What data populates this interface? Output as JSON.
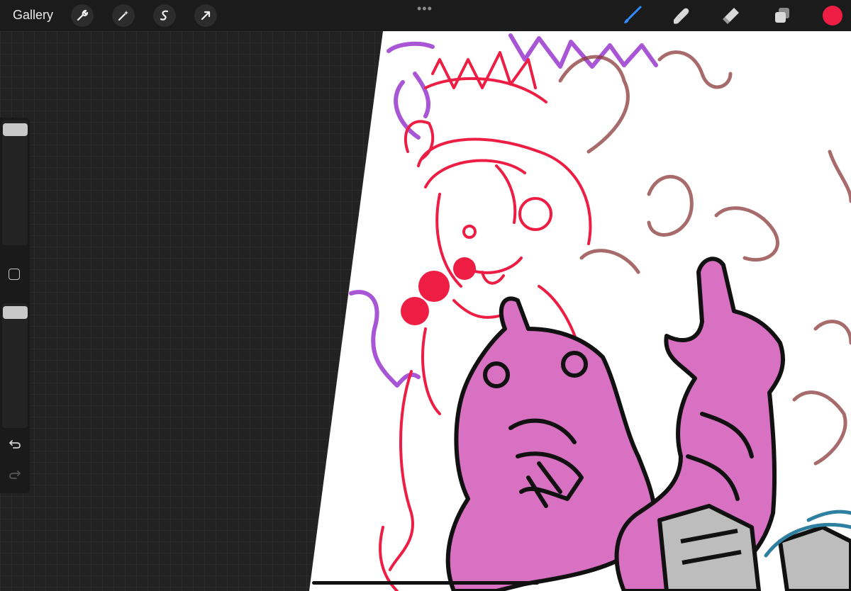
{
  "topbar": {
    "gallery_label": "Gallery",
    "left_tools": [
      "wrench-icon",
      "magic-wand-icon",
      "selection-s-icon",
      "transform-arrow-icon"
    ],
    "more_label": "•••",
    "right_tools": [
      "brush-icon",
      "smudge-icon",
      "eraser-icon",
      "layers-icon"
    ],
    "active_tool": "brush-icon",
    "active_color": "#ee1d44"
  },
  "sidebar": {
    "brush_size_level": 0.95,
    "brush_opacity_level": 0.95,
    "modify_label": "",
    "undo_icon": "undo-icon",
    "redo_icon": "redo-icon"
  },
  "canvas": {
    "background": "#ffffff",
    "stroke_colors": [
      "#ee1d44",
      "#a855d6",
      "#8b3a3a",
      "#d971c2",
      "#111111",
      "#bdbdbd",
      "#2f7fa0"
    ]
  }
}
